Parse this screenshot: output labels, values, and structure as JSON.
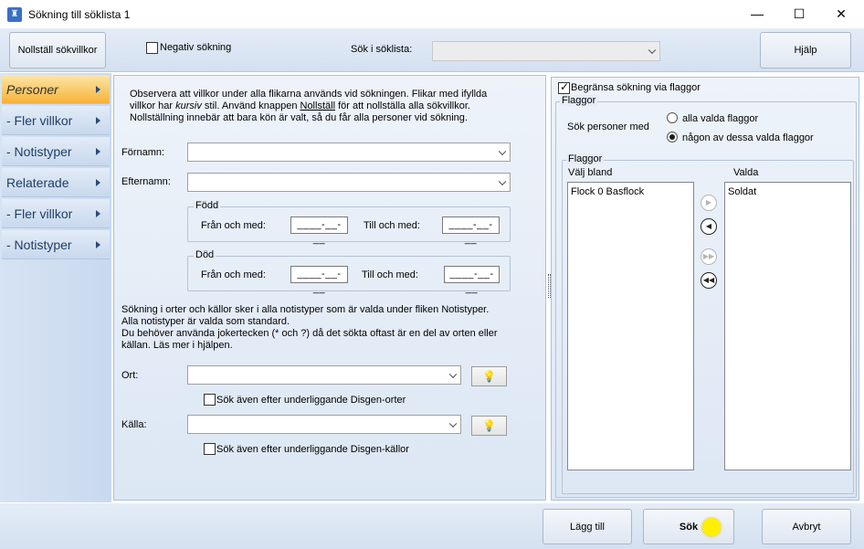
{
  "window": {
    "title": "Sökning till söklista 1",
    "icon_glyph": "♜",
    "minimize": "—",
    "maximize": "☐",
    "close": "✕"
  },
  "toolbar": {
    "reset_button": "Nollställ sökvillkor",
    "negative_search": "Negativ sökning",
    "search_in_list_label": "Sök i söklista:",
    "search_in_list_value": "",
    "help_button": "Hjälp"
  },
  "sidebar": {
    "items": [
      {
        "label": "Personer",
        "active": true
      },
      {
        "label": "- Fler villkor",
        "active": false
      },
      {
        "label": "- Notistyper",
        "active": false
      },
      {
        "label": "Relaterade",
        "active": false
      },
      {
        "label": "- Fler villkor",
        "active": false
      },
      {
        "label": "- Notistyper",
        "active": false
      }
    ]
  },
  "main": {
    "info_line1": "Observera att villkor under alla flikarna används vid sökningen. Flikar med ifyllda",
    "info_line2_pre": "villkor har ",
    "info_line2_italic": "kursiv",
    "info_line2_mid": " stil. Använd knappen ",
    "info_line2_underline": "Nollställ",
    "info_line2_post": " för att nollställa alla sökvillkor.",
    "info_line3": "Nollställning innebär att bara kön är valt, så du får alla personer vid sökning.",
    "firstname_label": "Förnamn:",
    "firstname_value": "",
    "lastname_label": "Efternamn:",
    "lastname_value": "",
    "born_group": "Född",
    "death_group": "Död",
    "from_label": "Från och med:",
    "to_label": "Till och med:",
    "date_mask": "____-__-__",
    "places_info_line1": "Sökning i orter och källor sker i alla notistyper som är valda under fliken Notistyper.",
    "places_info_line2": "Alla notistyper är valda som standard.",
    "places_info_line3": "Du behöver använda jokertecken (* och ?) då det sökta oftast är en del av orten eller",
    "places_info_line4": "källan. Läs mer i hjälpen.",
    "place_label": "Ort:",
    "place_value": "",
    "place_sub_label": "Sök även efter underliggande Disgen-orter",
    "source_label": "Källa:",
    "source_value": "",
    "source_sub_label": "Sök även efter underliggande Disgen-källor",
    "bulb_icon": "💡"
  },
  "flags": {
    "limit_label": "Begränsa sökning via flaggor",
    "group_title": "Flaggor",
    "search_persons_label": "Sök personer med",
    "option_all": "alla valda flaggor",
    "option_any": "någon av dessa valda flaggor",
    "inner_group_title": "Flaggor",
    "choose_from_label": "Välj bland",
    "selected_label": "Valda",
    "available": [
      "Flock 0 Basflock"
    ],
    "selected": [
      "Soldat"
    ]
  },
  "bottom": {
    "add_button": "Lägg till",
    "search_button": "Sök",
    "cancel_button": "Avbryt"
  }
}
